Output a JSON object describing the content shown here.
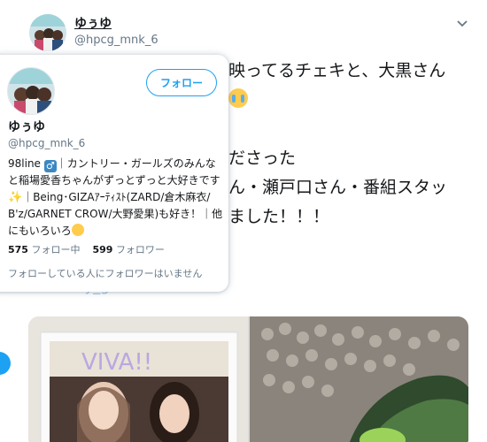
{
  "tweet": {
    "name": "ゆぅゆ",
    "handle": "@hpcg_mnk_6",
    "text_line1": "映ってるチェキと、大黒さん",
    "text_line3": "ださった",
    "text_line4": "ん・瀬戸口さん・番組スタッ",
    "text_line5": "ました！！！",
    "link_text": "country_girls",
    "caret_icon": "chevron-down-icon",
    "media_text": "VIVA!!"
  },
  "hover_card": {
    "name": "ゆぅゆ",
    "handle": "@hpcg_mnk_6",
    "follow_label": "フォロー",
    "bio_part1": "98line ",
    "bio_part2": "｜カントリー・ガールズのみんなと稲場愛香ちゃんがずっとずっと大好きです",
    "bio_part3": "｜Being･GIZAｱｰﾃｨｽﾄ(ZARD/倉木麻衣/B'z/GARNET CROW/大野愛果)も好き！｜他にもいろいろ",
    "following_count": "575",
    "following_label": "フォロー中",
    "followers_count": "599",
    "followers_label": "フォロワー",
    "mutual_text": "フォローしている人にフォロワーはいません"
  },
  "colors": {
    "accent": "#1da1f2",
    "text_primary": "#14171a",
    "text_secondary": "#657786"
  }
}
